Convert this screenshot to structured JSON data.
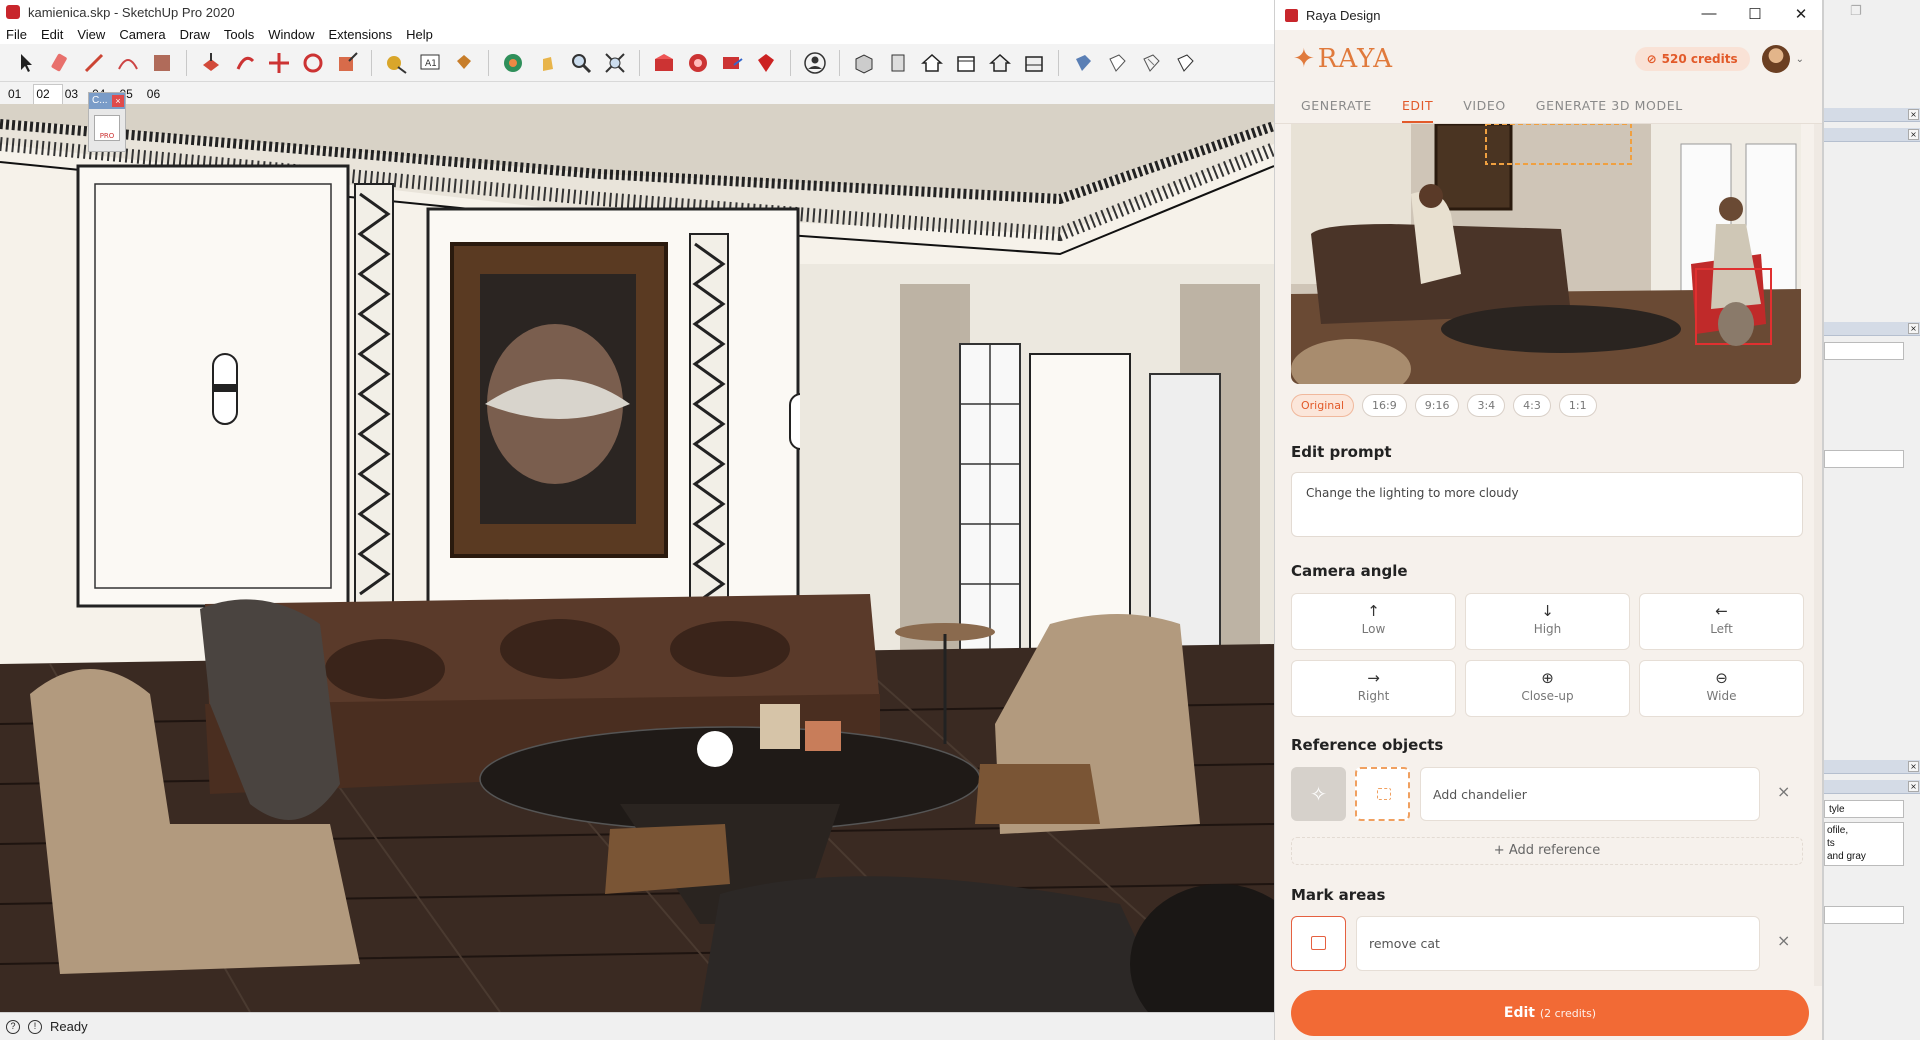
{
  "sketchup": {
    "title": "kamienica.skp - SketchUp Pro 2020",
    "menu": [
      "File",
      "Edit",
      "View",
      "Camera",
      "Draw",
      "Tools",
      "Window",
      "Extensions",
      "Help"
    ],
    "scenes": [
      "01",
      "02",
      "03",
      "04",
      "05",
      "06"
    ],
    "active_scene": "02",
    "components_panel": {
      "title": "C...",
      "close": "×",
      "badge": "PRO"
    },
    "status": {
      "text": "Ready",
      "icon1": "?",
      "icon2": "!"
    }
  },
  "trays": {
    "window_controls": "❐",
    "header_close": "×",
    "style_label": "tyle",
    "style_desc_lines": [
      "ofile,",
      "ts",
      "and gray"
    ],
    "icons": [
      "lock-icon",
      "paint-bucket-icon",
      "eyedropper-icon",
      "arrow-right-icon",
      "refresh-icon"
    ],
    "scroll_up": "˄",
    "scroll_down": "˅"
  },
  "raya": {
    "window_title": "Raya Design",
    "controls": {
      "minimize": "—",
      "maximize": "☐",
      "close": "✕"
    },
    "logo": {
      "star": "✦",
      "text": "RAYA"
    },
    "credits": {
      "icon": "⊘",
      "text": "520 credits"
    },
    "avatar_caret": "⌄",
    "tabs": [
      "GENERATE",
      "EDIT",
      "VIDEO",
      "GENERATE 3D MODEL"
    ],
    "active_tab": "EDIT",
    "aspect_ratios": [
      "Original",
      "16:9",
      "9:16",
      "3:4",
      "4:3",
      "1:1"
    ],
    "active_aspect": "Original",
    "edit_prompt": {
      "title": "Edit prompt",
      "value": "Change the lighting to more cloudy"
    },
    "camera_angle": {
      "title": "Camera angle",
      "buttons": [
        {
          "label": "Low",
          "icon": "↑"
        },
        {
          "label": "High",
          "icon": "↓"
        },
        {
          "label": "Left",
          "icon": "←"
        },
        {
          "label": "Right",
          "icon": "→"
        },
        {
          "label": "Close-up",
          "icon": "⊕"
        },
        {
          "label": "Wide",
          "icon": "⊖"
        }
      ]
    },
    "reference_objects": {
      "title": "Reference objects",
      "thumb_icon": "✧",
      "items": [
        {
          "value": "Add chandelier",
          "remove": "×"
        }
      ],
      "add_label": "+ Add reference"
    },
    "mark_areas": {
      "title": "Mark areas",
      "items": [
        {
          "value": "remove cat",
          "remove": "×"
        }
      ]
    },
    "edit_button": {
      "label": "Edit",
      "credits": "(2 credits)"
    },
    "colors": {
      "accent": "#f26a35",
      "credits_bg": "#f9e2d6",
      "panel_bg": "#f6f1ec"
    }
  }
}
